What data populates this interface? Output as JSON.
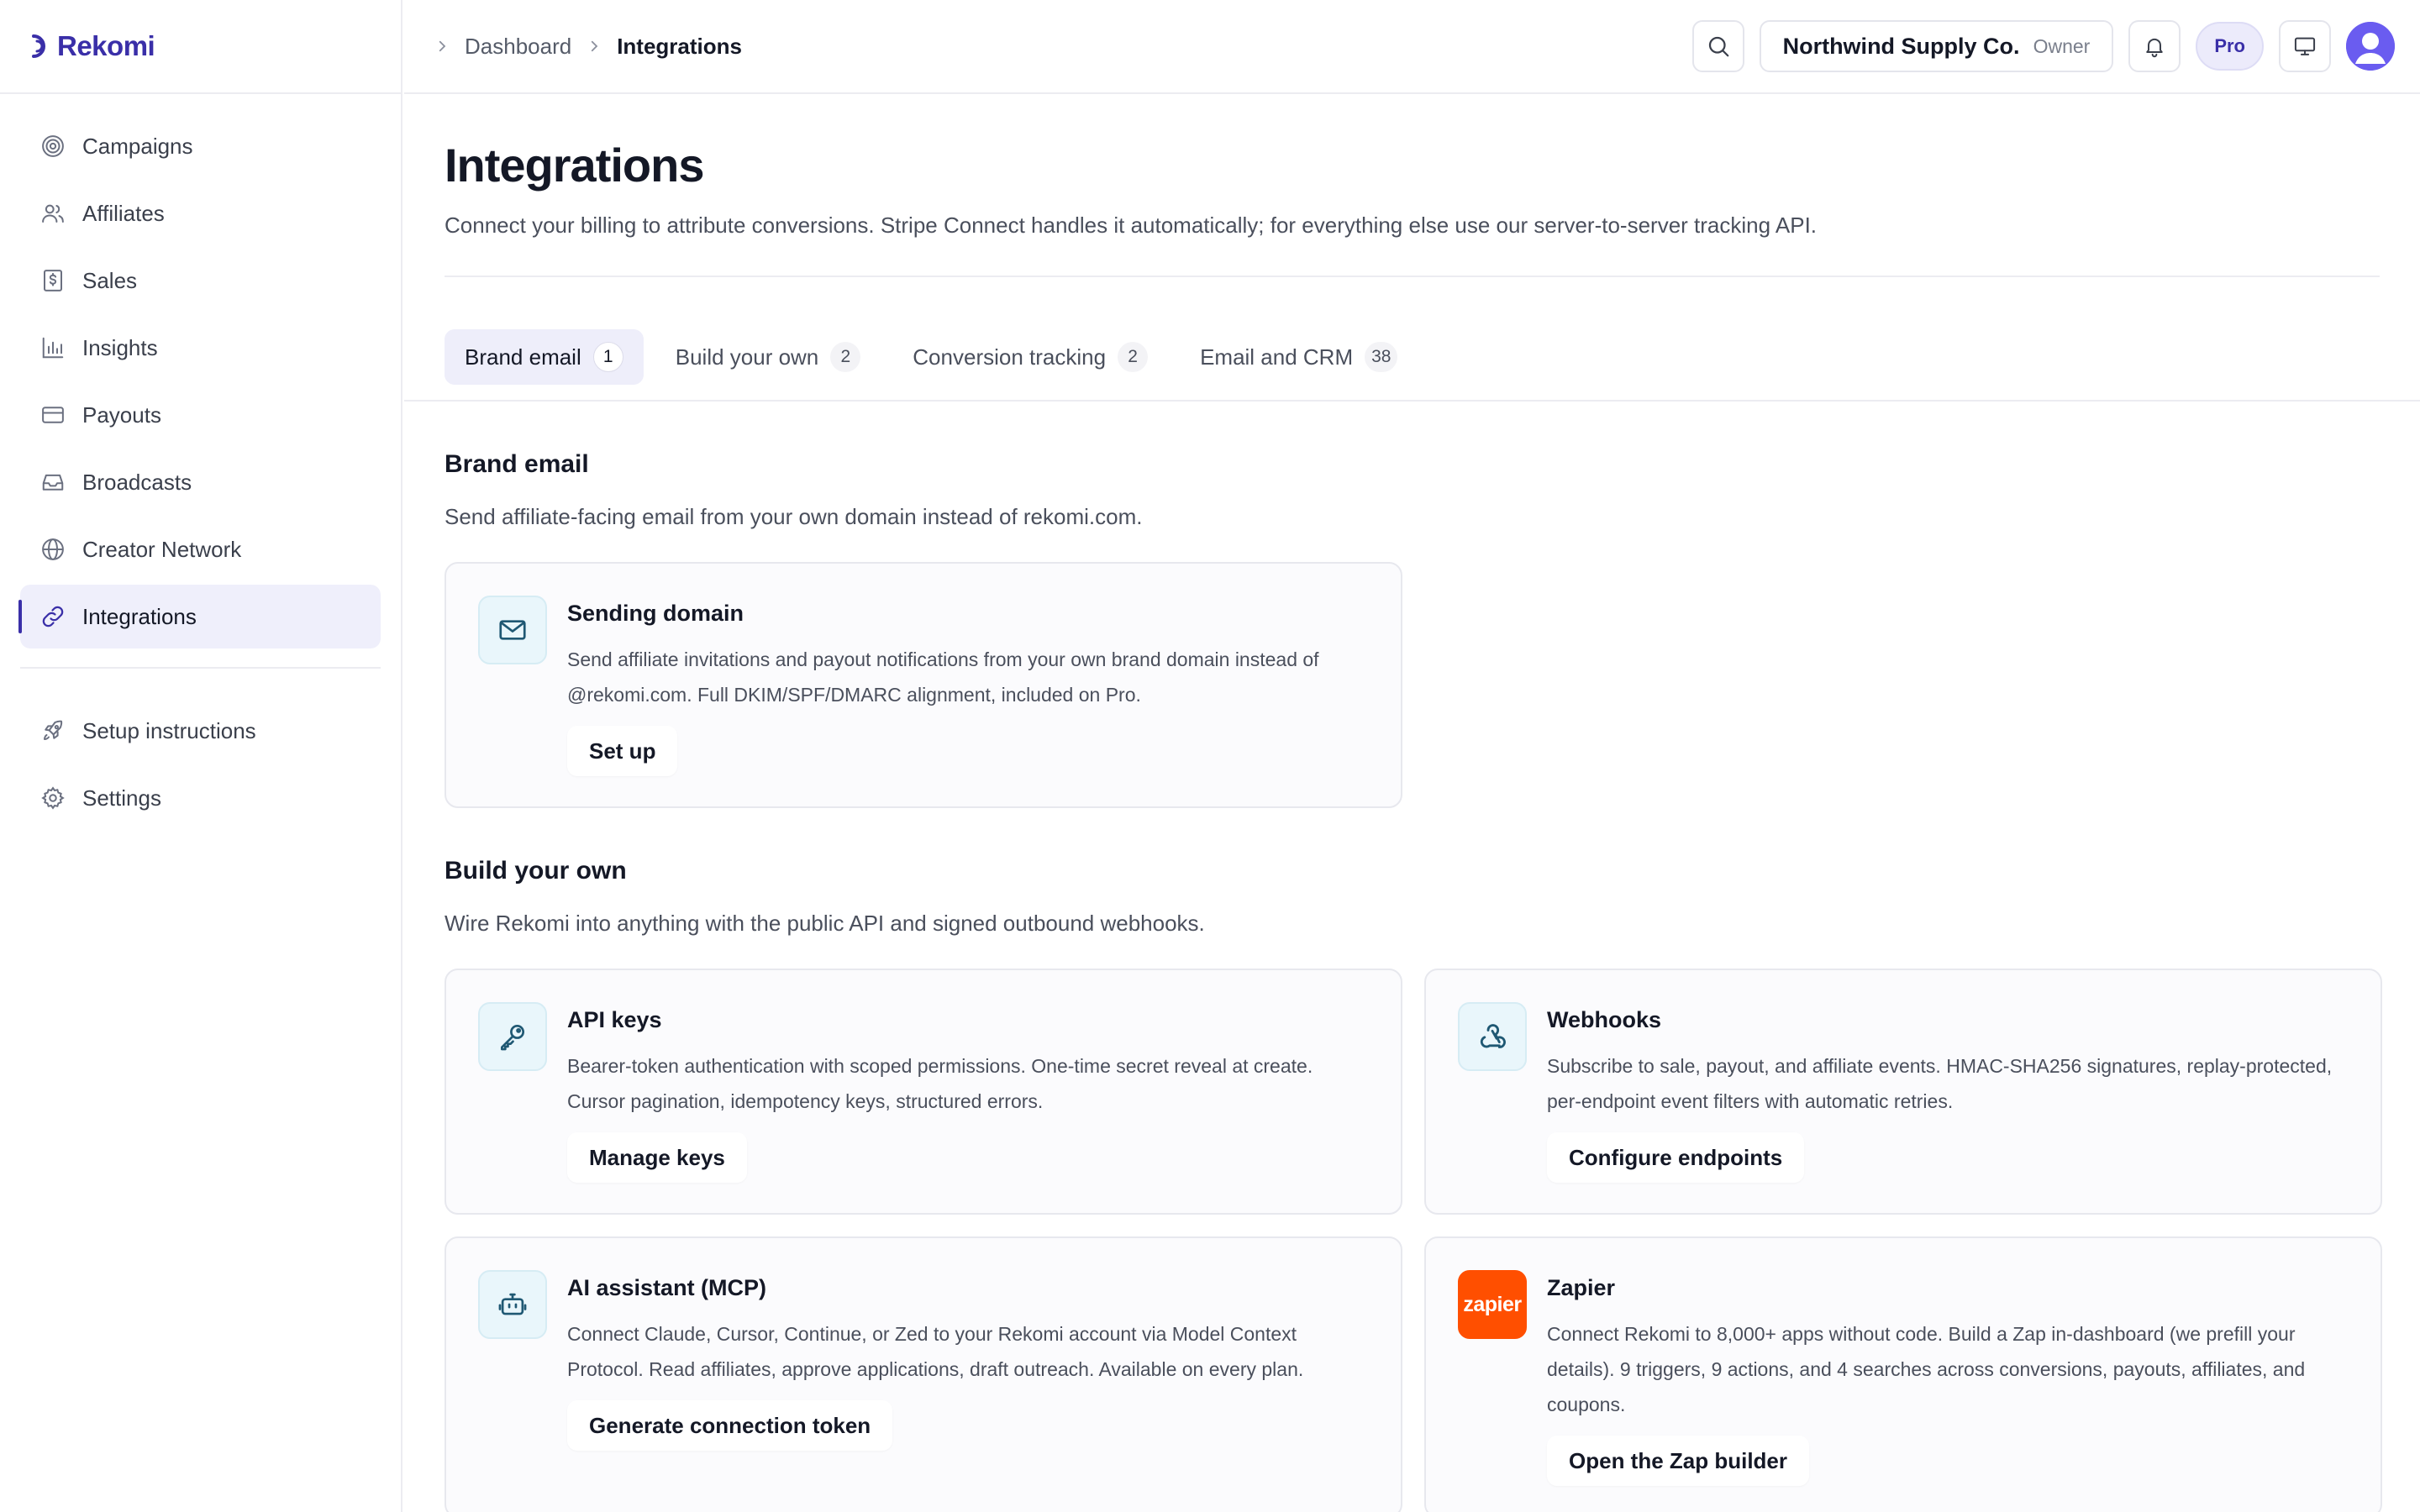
{
  "app": {
    "brand_name": "Rekomi"
  },
  "sidebar": {
    "items": [
      {
        "label": "Campaigns",
        "icon": "target-icon"
      },
      {
        "label": "Affiliates",
        "icon": "users-icon"
      },
      {
        "label": "Sales",
        "icon": "receipt-dollar-icon"
      },
      {
        "label": "Insights",
        "icon": "bar-chart-icon"
      },
      {
        "label": "Payouts",
        "icon": "credit-card-icon"
      },
      {
        "label": "Broadcasts",
        "icon": "inbox-icon"
      },
      {
        "label": "Creator Network",
        "icon": "globe-icon"
      },
      {
        "label": "Integrations",
        "icon": "link-icon",
        "active": true
      }
    ],
    "secondary": [
      {
        "label": "Setup instructions",
        "icon": "rocket-icon"
      },
      {
        "label": "Settings",
        "icon": "gear-icon"
      }
    ]
  },
  "topbar": {
    "breadcrumb": [
      "Dashboard",
      "Integrations"
    ],
    "org_name": "Northwind Supply Co.",
    "org_role": "Owner",
    "plan": "Pro"
  },
  "page": {
    "title": "Integrations",
    "description": "Connect your billing to attribute conversions. Stripe Connect handles it automatically; for everything else use our server-to-server tracking API."
  },
  "tabs": [
    {
      "label": "Brand email",
      "count": "1",
      "active": true
    },
    {
      "label": "Build your own",
      "count": "2"
    },
    {
      "label": "Conversion tracking",
      "count": "2"
    },
    {
      "label": "Email and CRM",
      "count": "38"
    }
  ],
  "sections": {
    "brand_email": {
      "title": "Brand email",
      "description": "Send affiliate-facing email from your own domain instead of rekomi.com.",
      "cards": [
        {
          "title": "Sending domain",
          "icon": "mail-icon",
          "text": "Send affiliate invitations and payout notifications from your own brand domain instead of @rekomi.com. Full DKIM/SPF/DMARC alignment, included on Pro.",
          "action": "Set up"
        }
      ]
    },
    "build_your_own": {
      "title": "Build your own",
      "description": "Wire Rekomi into anything with the public API and signed outbound webhooks.",
      "cards": [
        {
          "title": "API keys",
          "icon": "key-icon",
          "text": "Bearer-token authentication with scoped permissions. One-time secret reveal at create. Cursor pagination, idempotency keys, structured errors.",
          "action": "Manage keys"
        },
        {
          "title": "Webhooks",
          "icon": "webhook-icon",
          "text": "Subscribe to sale, payout, and affiliate events. HMAC-SHA256 signatures, replay-protected, per-endpoint event filters with automatic retries.",
          "action": "Configure endpoints"
        },
        {
          "title": "AI assistant (MCP)",
          "icon": "bot-icon",
          "text": "Connect Claude, Cursor, Continue, or Zed to your Rekomi account via Model Context Protocol. Read affiliates, approve applications, draft outreach. Available on every plan.",
          "action": "Generate connection token"
        },
        {
          "title": "Zapier",
          "icon": "zapier-logo",
          "logo_text": "zapier",
          "text": "Connect Rekomi to 8,000+ apps without code. Build a Zap in-dashboard (we prefill your details). 9 triggers, 9 actions, and 4 searches across conversions, payouts, affiliates, and coupons.",
          "action": "Open the Zap builder"
        }
      ]
    }
  },
  "colors": {
    "accent": "#3a2fa8",
    "zapier": "#ff4f00",
    "avatar": "#6a5cf0"
  }
}
